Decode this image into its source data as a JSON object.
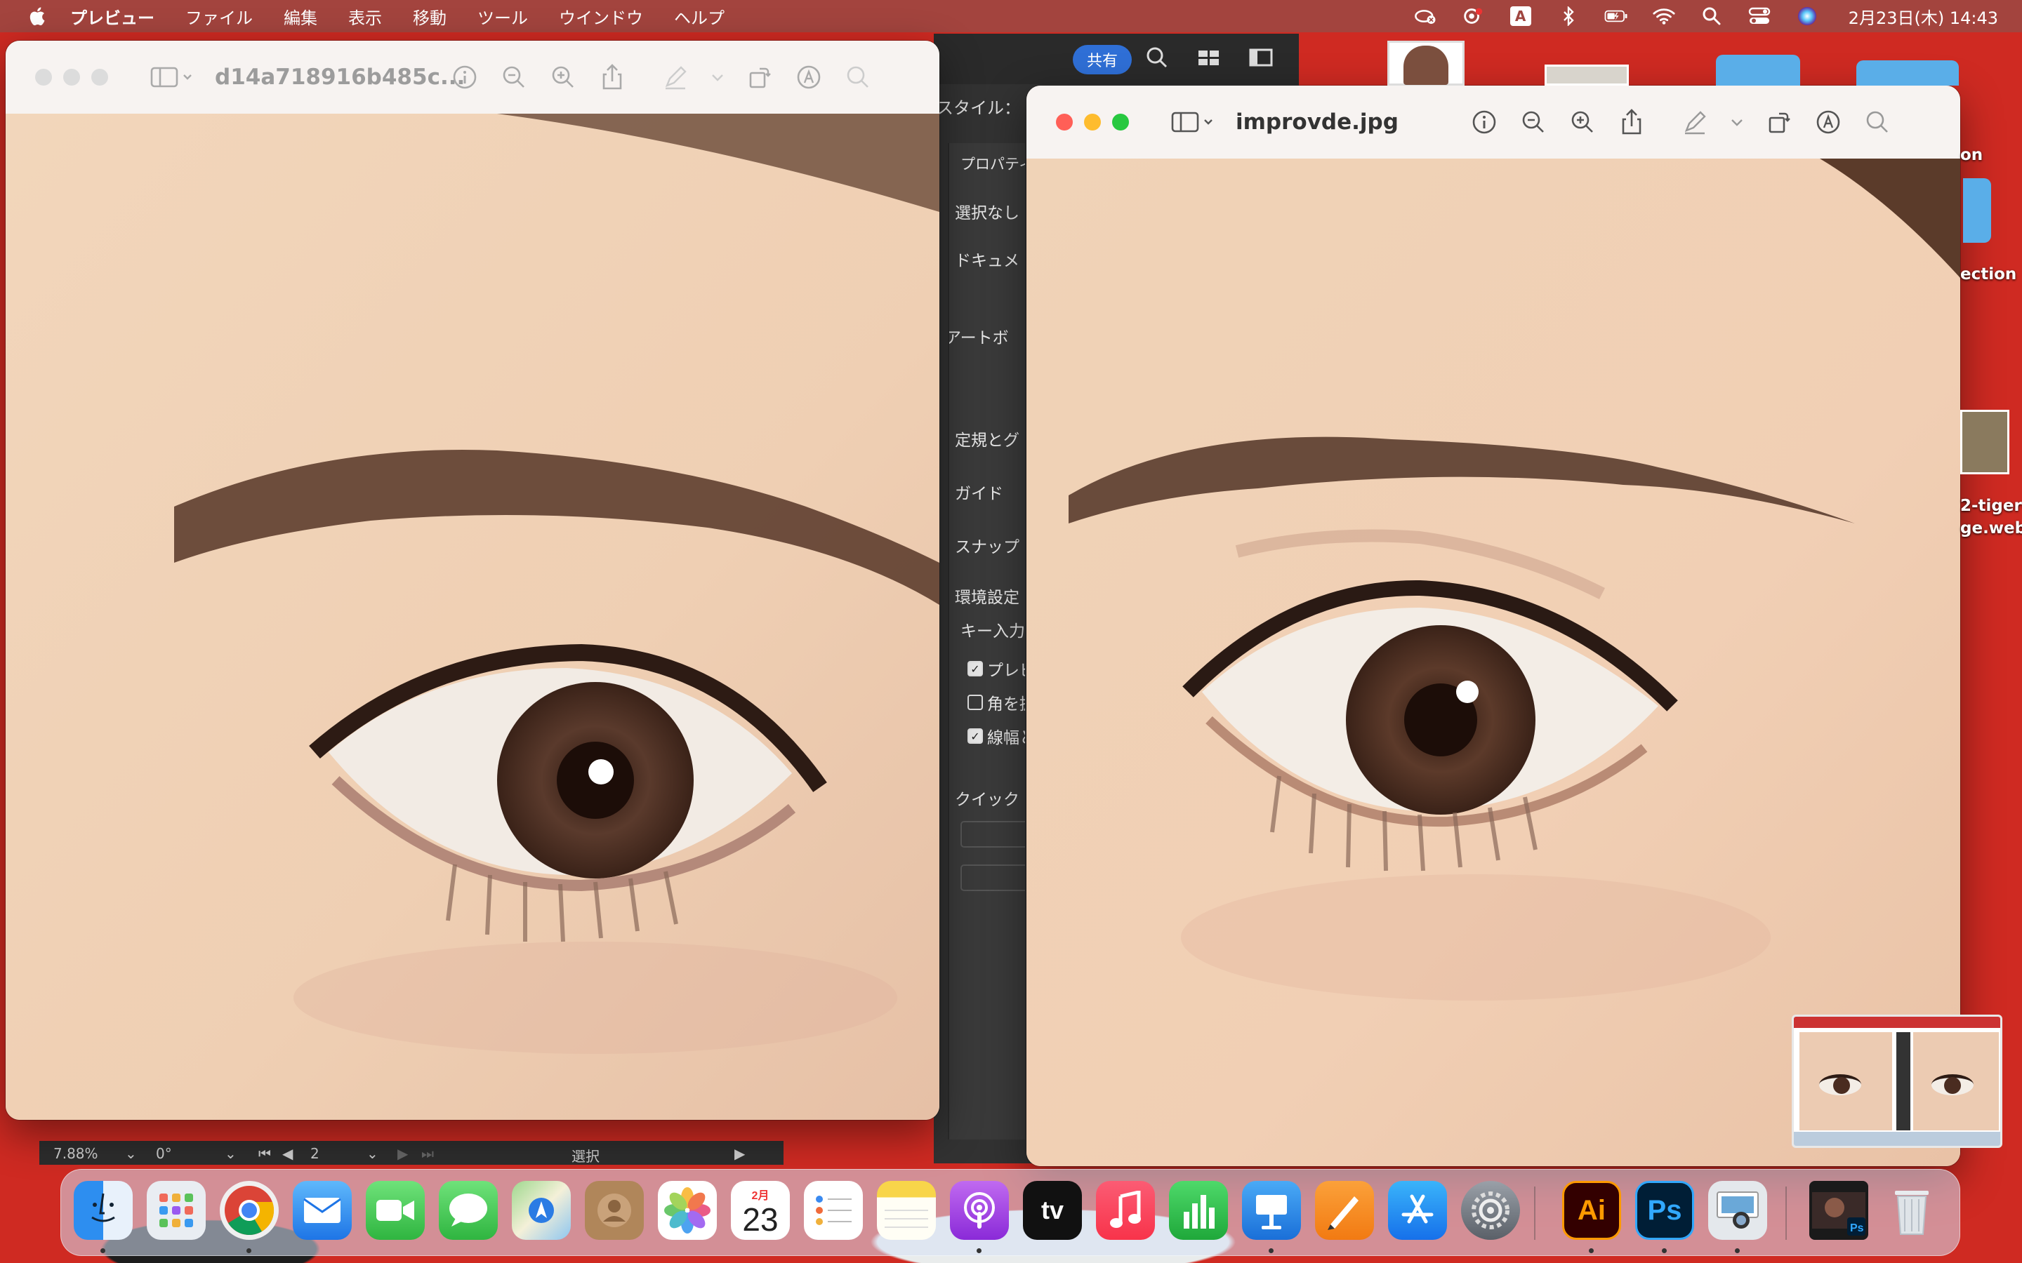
{
  "menubar": {
    "app_name": "プレビュー",
    "items": [
      "ファイル",
      "編集",
      "表示",
      "移動",
      "ツール",
      "ウインドウ",
      "ヘルプ"
    ],
    "clock": "2月23日(木) 14:43",
    "input_indicator": "A"
  },
  "illustrator": {
    "share_label": "共有",
    "style_label": "スタイル：",
    "panel": {
      "properties": "プロパティ",
      "no_selection": "選択なし",
      "document": "ドキュメ",
      "artboard": "アートボ",
      "rulers": "定規とグ",
      "guides": "ガイド",
      "snap": "スナップ",
      "prefs": "環境設定",
      "key_input": "キー入力",
      "cb_preview": "プレビ",
      "cb_corners": "角を拡",
      "cb_stroke": "線幅と",
      "quick": "クイック"
    },
    "statusbar": {
      "zoom": "7.88%",
      "rotation": "0°",
      "artboard_num": "2",
      "tool": "選択"
    }
  },
  "window_left": {
    "title": "d14a718916b485c..."
  },
  "window_right": {
    "title": "improvde.jpg"
  },
  "desktop": {
    "label_connection": "ection",
    "label_file1": "2-tiger-",
    "label_file2": "ge.webp",
    "label_on": "on"
  },
  "dock": {
    "calendar_month": "2月",
    "calendar_day": "23",
    "apps": [
      "Finder",
      "Launchpad",
      "Google Chrome",
      "Mail",
      "FaceTime",
      "Messages",
      "Maps",
      "Contacts",
      "Photos",
      "Calendar",
      "Reminders",
      "Notes",
      "Podcasts",
      "Apple TV",
      "Music",
      "Numbers",
      "Keynote",
      "Pages",
      "App Store",
      "System Settings",
      "Illustrator",
      "Photoshop",
      "Preview",
      "Photoshop document",
      "Trash"
    ],
    "ai_label": "Ai",
    "ps_label": "Ps",
    "tv_label": "tv"
  },
  "colors": {
    "menubar": "#a04640",
    "desktop_red": "#cf2a22",
    "accent_blue": "#2f6fd6",
    "close": "#ff5f57",
    "minimize": "#febc2e",
    "zoom": "#28c840"
  }
}
